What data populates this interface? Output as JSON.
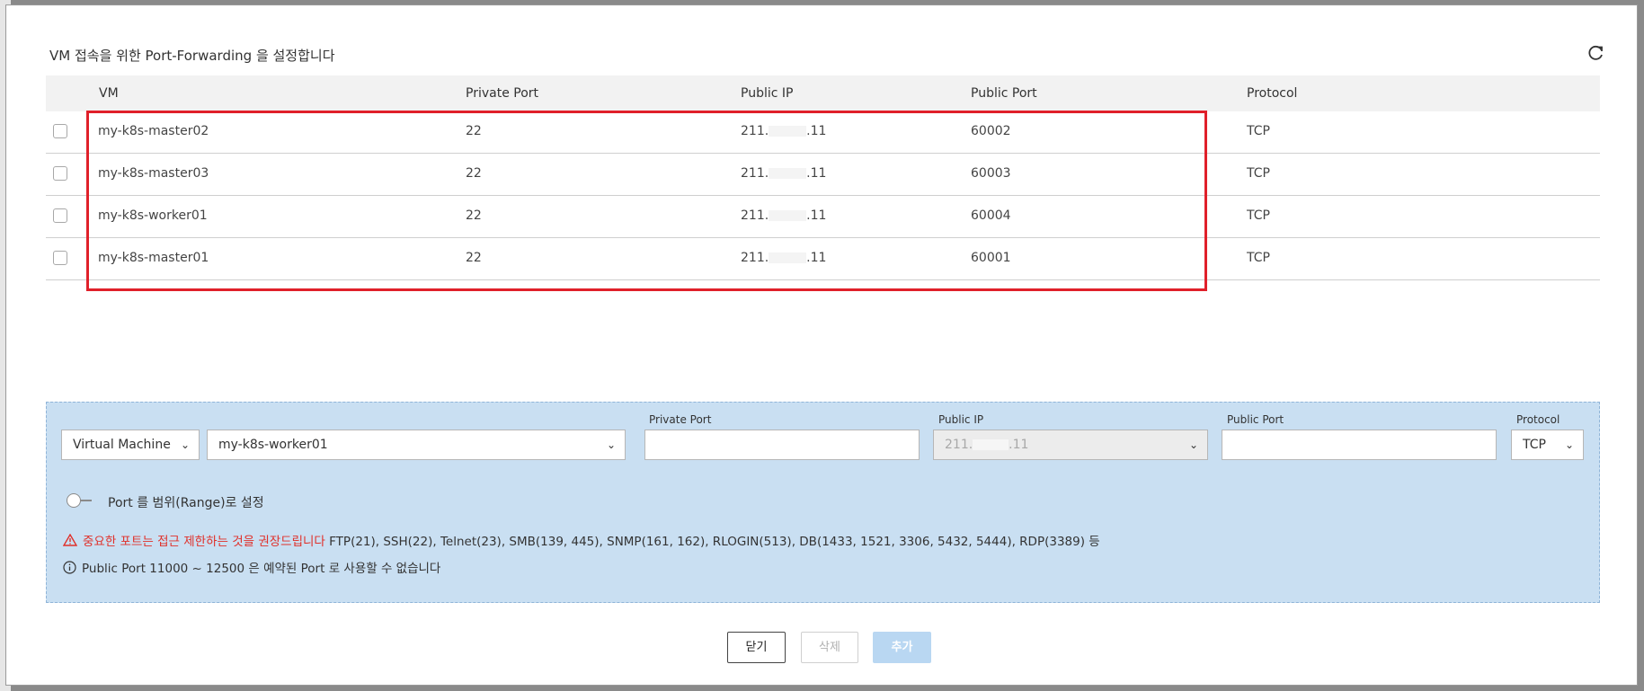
{
  "modal": {
    "title": "VM 접속을 위한 Port-Forwarding 을 설정합니다",
    "refresh_icon": "refresh-icon"
  },
  "table": {
    "headers": {
      "vm": "VM",
      "private_port": "Private Port",
      "public_ip": "Public IP",
      "public_port": "Public Port",
      "protocol": "Protocol"
    },
    "rows": [
      {
        "vm": "my-k8s-master02",
        "private_port": "22",
        "ip_prefix": "211.",
        "ip_suffix": ".11",
        "public_port": "60002",
        "protocol": "TCP"
      },
      {
        "vm": "my-k8s-master03",
        "private_port": "22",
        "ip_prefix": "211.",
        "ip_suffix": ".11",
        "public_port": "60003",
        "protocol": "TCP"
      },
      {
        "vm": "my-k8s-worker01",
        "private_port": "22",
        "ip_prefix": "211.",
        "ip_suffix": ".11",
        "public_port": "60004",
        "protocol": "TCP"
      },
      {
        "vm": "my-k8s-master01",
        "private_port": "22",
        "ip_prefix": "211.",
        "ip_suffix": ".11",
        "public_port": "60001",
        "protocol": "TCP"
      }
    ]
  },
  "form": {
    "type_select": "Virtual Machine",
    "vm_select": "my-k8s-worker01",
    "private_port_label": "Private Port",
    "private_port_value": "",
    "public_ip_label": "Public IP",
    "public_ip_prefix": "211.",
    "public_ip_suffix": ".11",
    "public_port_label": "Public Port",
    "public_port_value": "",
    "protocol_label": "Protocol",
    "protocol_select": "TCP",
    "range_toggle_label": "Port 를 범위(Range)로 설정",
    "warning_red": "중요한 포트는 접근 제한하는 것을 권장드립니다",
    "warning_text": "FTP(21), SSH(22), Telnet(23), SMB(139, 445), SNMP(161, 162), RLOGIN(513), DB(1433, 1521, 3306, 5432, 5444), RDP(3389) 등",
    "info_text": "Public Port 11000 ~ 12500 은 예약된 Port 로 사용할 수 없습니다"
  },
  "buttons": {
    "close": "닫기",
    "delete": "삭제",
    "add": "추가"
  },
  "colors": {
    "accent_highlight": "#e0202a",
    "panel_bg": "#c9dff2",
    "warning": "#e0302a",
    "add_button": "#b9d7f2"
  }
}
